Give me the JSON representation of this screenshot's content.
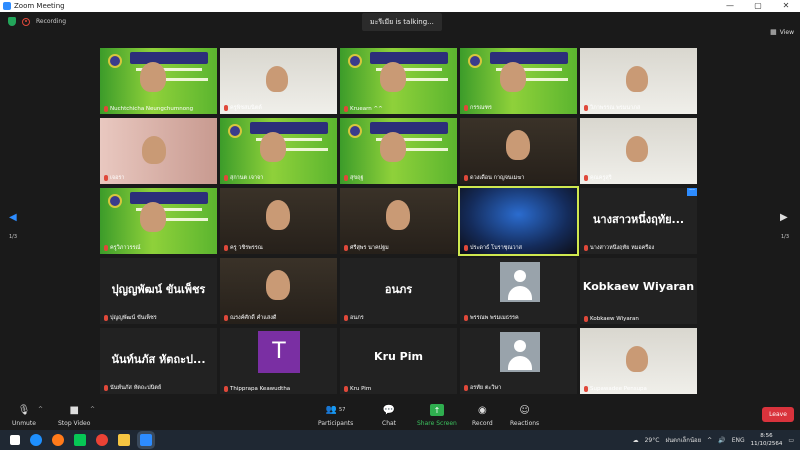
{
  "window": {
    "title": "Zoom Meeting",
    "controls": [
      "—",
      "▢",
      "✕"
    ]
  },
  "topbar": {
    "recording_label": "Recording",
    "talking": "มะรีเมีย is talking...",
    "view_label": "View"
  },
  "pager": {
    "left_page": "1/3",
    "right_page": "1/3"
  },
  "tiles": [
    {
      "name": "Nuchtchicha Neungchumnong",
      "kind": "slide",
      "active": false
    },
    {
      "name": "ครูพิชสมนิตต์",
      "kind": "room-light",
      "active": false
    },
    {
      "name": "Kruearn ^^",
      "kind": "slide",
      "active": false
    },
    {
      "name": "กรรณฑร",
      "kind": "slide",
      "active": false
    },
    {
      "name": "วิภาพรรณ พรมนาภส",
      "kind": "room-light",
      "active": false
    },
    {
      "name": "เจอรา",
      "kind": "room-pink",
      "active": false
    },
    {
      "name": "สุกานต เจาจา",
      "kind": "slide",
      "active": false
    },
    {
      "name": "สุขฤฐ",
      "kind": "slide",
      "active": false
    },
    {
      "name": "ดวงเดือน กาญจนเมฆา",
      "kind": "room-dark",
      "active": false
    },
    {
      "name": "คุณครูสุริ",
      "kind": "room-light",
      "active": false
    },
    {
      "name": "ครูวิภาวรรณ์",
      "kind": "slide",
      "active": false
    },
    {
      "name": "ครู วชิรพรรณ",
      "kind": "room-dark",
      "active": false
    },
    {
      "name": "ศรีสุพร นาคปฐม",
      "kind": "room-dark",
      "active": false
    },
    {
      "name": "ประดาธ์ โบราชุณวาส",
      "kind": "room-stage",
      "active": true
    },
    {
      "name": "นางสาวหนึ่งฤทัย หมอครือง",
      "kind": "text",
      "big": "นางสาวหนึ่งฤทัย...",
      "active": false,
      "more": "···"
    },
    {
      "name": "ปุญญพัฒน์ ขันเพ็ชร",
      "kind": "text",
      "big": "ปุญญพัฒน์ ขันเพ็ชร",
      "active": false
    },
    {
      "name": "ณรงค์ศักดิ์ คำแสงดี",
      "kind": "room-dark",
      "active": false
    },
    {
      "name": "อนภร",
      "kind": "text",
      "big": "อนภร",
      "active": false
    },
    {
      "name": "พรรณพ พรมเมธรรค",
      "kind": "avatar",
      "active": false
    },
    {
      "name": "Kobkaew Wiyaran",
      "kind": "text",
      "big": "Kobkaew Wiyaran",
      "active": false
    },
    {
      "name": "นันท์นภัส หัตถะปนิตย์",
      "kind": "text",
      "big": "นันท์นภัส หัตถะป...",
      "active": false
    },
    {
      "name": "Thipprapa Keawudtha",
      "kind": "letter",
      "letter": "T",
      "active": false
    },
    {
      "name": "Kru Pim",
      "kind": "text",
      "big": "Kru Pim",
      "active": false
    },
    {
      "name": "อรทัย ตะวิษา",
      "kind": "avatar",
      "active": false
    },
    {
      "name": "Supawadee Pensupa",
      "kind": "room-light",
      "active": false
    }
  ],
  "toolbar": {
    "unmute": "Unmute",
    "stop_video": "Stop Video",
    "participants": "Participants",
    "participants_count": "57",
    "chat": "Chat",
    "share_screen": "Share Screen",
    "record": "Record",
    "reactions": "Reactions",
    "leave": "Leave"
  },
  "taskbar": {
    "weather": "29°C",
    "weather_text": "ฝนตกเล็กน้อย",
    "lang": "ENG",
    "time": "8:56",
    "date": "11/10/2564"
  },
  "colors": {
    "accent": "#2d8cff",
    "share": "#2fae4f",
    "leave": "#d9333c",
    "active_outline": "#cfe84f"
  }
}
